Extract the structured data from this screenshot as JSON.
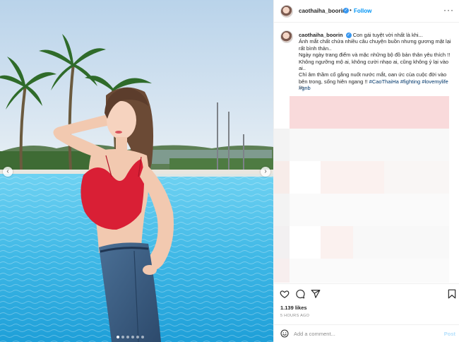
{
  "post": {
    "username": "caothaiha_boorin",
    "separator": "•",
    "follow_label": "Follow",
    "more_icon": "more-horizontal-icon",
    "caption_lines": [
      "Con gái tuyệt vời nhất là khi...",
      "Ánh mắt chất chứa nhiều câu chuyện buồn nhưng gương mặt lại rất bình thản..",
      "Ngày ngày trang điểm và mặc những bộ đồ bản thân yêu thích !!",
      "Không ngưỡng mộ ai, không cười nhạo ai, cũng không ỷ lại vào ai..",
      "Chỉ âm thầm cố gắng nuốt nước mắt, oan ức của cuộc đời vào bên trong, sống hiên ngang !!"
    ],
    "hashtags": [
      "#CaoThaiHa",
      "#fighting",
      "#lovemylife",
      "#gnb"
    ],
    "caption_time": "5h",
    "likes": "1.139 likes",
    "post_time": "5 HOURS AGO",
    "comment_placeholder": "Add a comment...",
    "post_label": "Post",
    "carousel": {
      "slides": 6,
      "active": 0
    }
  },
  "colors": {
    "link_blue": "#0095f6",
    "verified_blue": "#3897f0",
    "muted_text": "#8e8e8e",
    "pool": "#3fb8e6",
    "top_red": "#d91f35"
  }
}
